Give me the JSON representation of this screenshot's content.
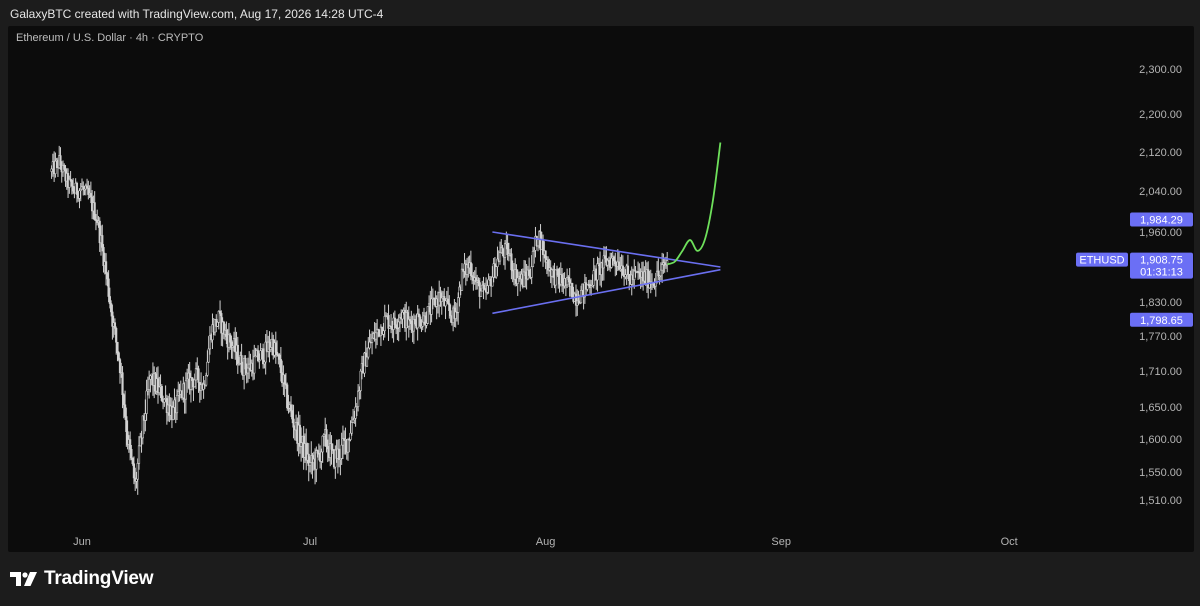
{
  "header": {
    "text": "GalaxyBTC created with TradingView.com, Aug 17, 2026 14:28 UTC-4"
  },
  "symbol": {
    "text": "Ethereum / U.S. Dollar · 4h · CRYPTO"
  },
  "brand": {
    "name": "TradingView",
    "icon": "tradingview-logo-icon"
  },
  "colors": {
    "candle": "#d1d1d1",
    "trendline": "#6a6ff0",
    "projection": "#6ee05b",
    "label_bg": "#6b6ff5",
    "panel_bg": "#0c0c0c",
    "axis_text": "#b4b4b4"
  },
  "chart_data": {
    "type": "candlestick",
    "symbol": "ETHUSD",
    "interval": "4h",
    "x_axis_labels": [
      "Jun",
      "Jul",
      "Aug",
      "Sep",
      "Oct"
    ],
    "y_ticks": [
      2300,
      2200,
      2120,
      2040,
      1960,
      1830,
      1770,
      1710,
      1650,
      1600,
      1550,
      1510
    ],
    "y_tick_labels": [
      "2,300.00",
      "2,200.00",
      "2,120.00",
      "2,040.00",
      "1,960.00",
      "1,830.00",
      "1,770.00",
      "1,710.00",
      "1,650.00",
      "1,600.00",
      "1,550.00",
      "1,510.00"
    ],
    "price_labels": [
      {
        "name": "resistance",
        "value": 1984.29,
        "text": "1,984.29"
      },
      {
        "name": "current",
        "value": 1908.75,
        "text": "1,908.75",
        "symbol": "ETHUSD",
        "countdown": "01:31:13"
      },
      {
        "name": "support",
        "value": 1798.65,
        "text": "1,798.65"
      }
    ],
    "close_path": [
      [
        "May 28",
        2080
      ],
      [
        "May 29",
        2100
      ],
      [
        "May 30",
        2060
      ],
      [
        "May 31",
        2040
      ],
      [
        "Jun 1",
        2045
      ],
      [
        "Jun 2",
        2025
      ],
      [
        "Jun 3",
        1985
      ],
      [
        "Jun 4",
        1900
      ],
      [
        "Jun 5",
        1800
      ],
      [
        "Jun 6",
        1720
      ],
      [
        "Jun 7",
        1600
      ],
      [
        "Jun 8",
        1530
      ],
      [
        "Jun 9",
        1620
      ],
      [
        "Jun 10",
        1700
      ],
      [
        "Jun 11",
        1680
      ],
      [
        "Jun 12",
        1660
      ],
      [
        "Jun 13",
        1640
      ],
      [
        "Jun 14",
        1670
      ],
      [
        "Jun 15",
        1690
      ],
      [
        "Jun 16",
        1700
      ],
      [
        "Jun 17",
        1685
      ],
      [
        "Jun 18",
        1780
      ],
      [
        "Jun 19",
        1800
      ],
      [
        "Jun 20",
        1770
      ],
      [
        "Jun 21",
        1750
      ],
      [
        "Jun 22",
        1720
      ],
      [
        "Jun 23",
        1715
      ],
      [
        "Jun 24",
        1730
      ],
      [
        "Jun 25",
        1740
      ],
      [
        "Jun 26",
        1760
      ],
      [
        "Jun 27",
        1720
      ],
      [
        "Jun 28",
        1660
      ],
      [
        "Jun 29",
        1620
      ],
      [
        "Jun 30",
        1590
      ],
      [
        "Jul 1",
        1560
      ],
      [
        "Jul 2",
        1570
      ],
      [
        "Jul 3",
        1600
      ],
      [
        "Jul 4",
        1570
      ],
      [
        "Jul 5",
        1580
      ],
      [
        "Jul 6",
        1600
      ],
      [
        "Jul 7",
        1650
      ],
      [
        "Jul 8",
        1720
      ],
      [
        "Jul 9",
        1760
      ],
      [
        "Jul 10",
        1780
      ],
      [
        "Jul 11",
        1800
      ],
      [
        "Jul 12",
        1790
      ],
      [
        "Jul 13",
        1810
      ],
      [
        "Jul 14",
        1790
      ],
      [
        "Jul 15",
        1800
      ],
      [
        "Jul 16",
        1800
      ],
      [
        "Jul 17",
        1820
      ],
      [
        "Jul 18",
        1840
      ],
      [
        "Jul 19",
        1820
      ],
      [
        "Jul 20",
        1800
      ],
      [
        "Jul 21",
        1880
      ],
      [
        "Jul 22",
        1900
      ],
      [
        "Jul 23",
        1860
      ],
      [
        "Jul 24",
        1840
      ],
      [
        "Jul 25",
        1880
      ],
      [
        "Jul 26",
        1920
      ],
      [
        "Jul 27",
        1925
      ],
      [
        "Jul 28",
        1880
      ],
      [
        "Jul 29",
        1870
      ],
      [
        "Jul 30",
        1890
      ],
      [
        "Jul 31",
        1960
      ],
      [
        "Aug 1",
        1910
      ],
      [
        "Aug 2",
        1880
      ],
      [
        "Aug 3",
        1870
      ],
      [
        "Aug 4",
        1860
      ],
      [
        "Aug 5",
        1840
      ],
      [
        "Aug 6",
        1850
      ],
      [
        "Aug 7",
        1870
      ],
      [
        "Aug 8",
        1890
      ],
      [
        "Aug 9",
        1905
      ],
      [
        "Aug 10",
        1910
      ],
      [
        "Aug 11",
        1900
      ],
      [
        "Aug 12",
        1870
      ],
      [
        "Aug 13",
        1880
      ],
      [
        "Aug 14",
        1875
      ],
      [
        "Aug 15",
        1870
      ],
      [
        "Aug 16",
        1880
      ],
      [
        "Aug 17",
        1905
      ]
    ],
    "drawings": {
      "triangle_upper": [
        [
          "Jul 25",
          1960
        ],
        [
          "Aug 24",
          1895
        ]
      ],
      "triangle_lower": [
        [
          "Jul 25",
          1810
        ],
        [
          "Aug 24",
          1890
        ]
      ],
      "projection": [
        [
          "Aug 17",
          1900
        ],
        [
          "Aug 18",
          1905
        ],
        [
          "Aug 19",
          1925
        ],
        [
          "Aug 20",
          1945
        ],
        [
          "Aug 21",
          1925
        ],
        [
          "Aug 22",
          1948
        ],
        [
          "Aug 23",
          2020
        ],
        [
          "Aug 24",
          2140
        ]
      ]
    }
  }
}
